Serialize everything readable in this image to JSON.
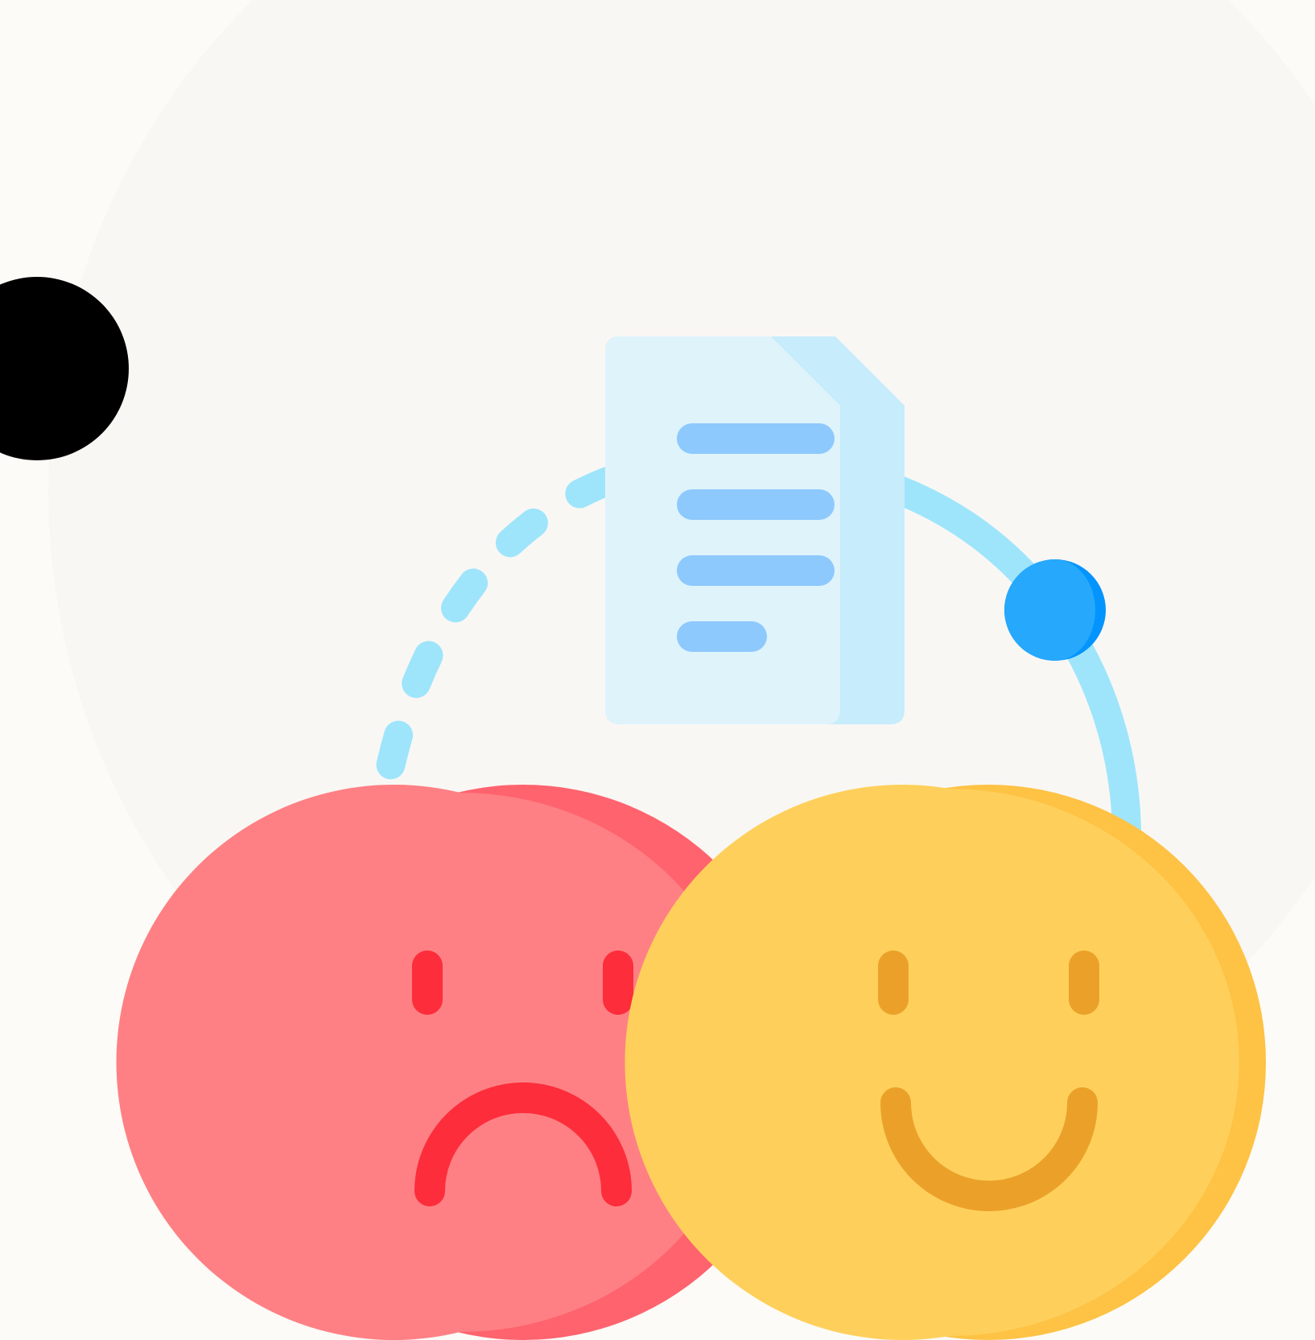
{
  "scene": {
    "illustration": "feedback-sentiment-icon",
    "elements": {
      "background_disc": "background-disc",
      "marker_dot": "black-dot",
      "document": "document-icon",
      "path_dashed": "dashed-arc",
      "path_solid": "solid-arc",
      "node": "blue-node-dot",
      "sad_face": "sad-face-icon",
      "happy_face": "happy-face-icon"
    }
  },
  "colors": {
    "page_background": "#fcfbf7",
    "disc": "#f9f7f4",
    "marker": "#000000",
    "document_front": "#dff3fb",
    "document_fold": "#c7ecfb",
    "document_lines": "#8ec9fd",
    "arc": "#9ee5fb",
    "node_light": "#26a8fc",
    "node_dark": "#0394fd",
    "sad_light": "#fe8084",
    "sad_dark": "#fe636e",
    "sad_feature": "#fd2d3b",
    "happy_light": "#fed05b",
    "happy_dark": "#fec244",
    "happy_feature": "#eba129"
  }
}
